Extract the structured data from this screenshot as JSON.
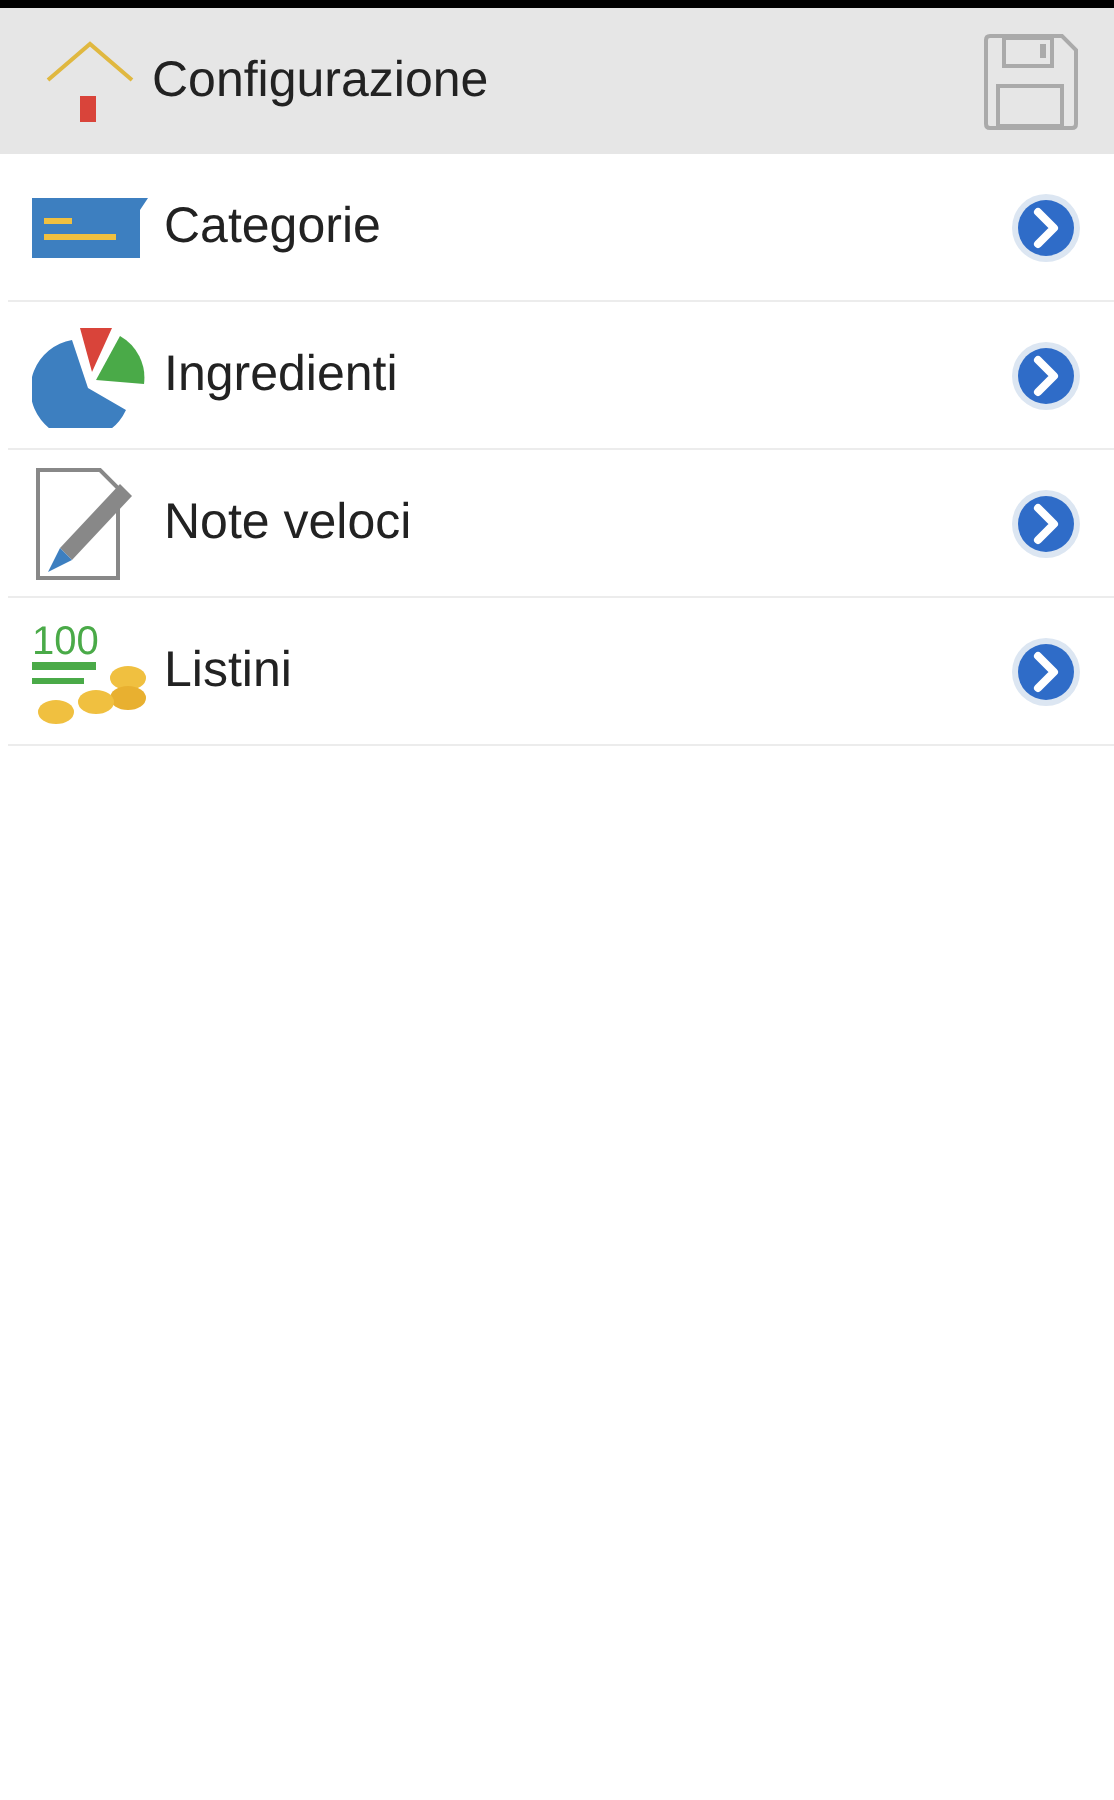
{
  "header": {
    "title": "Configurazione"
  },
  "items": [
    {
      "label": "Categorie",
      "kind": "tag"
    },
    {
      "label": "Ingredienti",
      "kind": "pie"
    },
    {
      "label": "Note veloci",
      "kind": "note"
    },
    {
      "label": "Listini",
      "kind": "money",
      "icon_text": "100"
    }
  ]
}
